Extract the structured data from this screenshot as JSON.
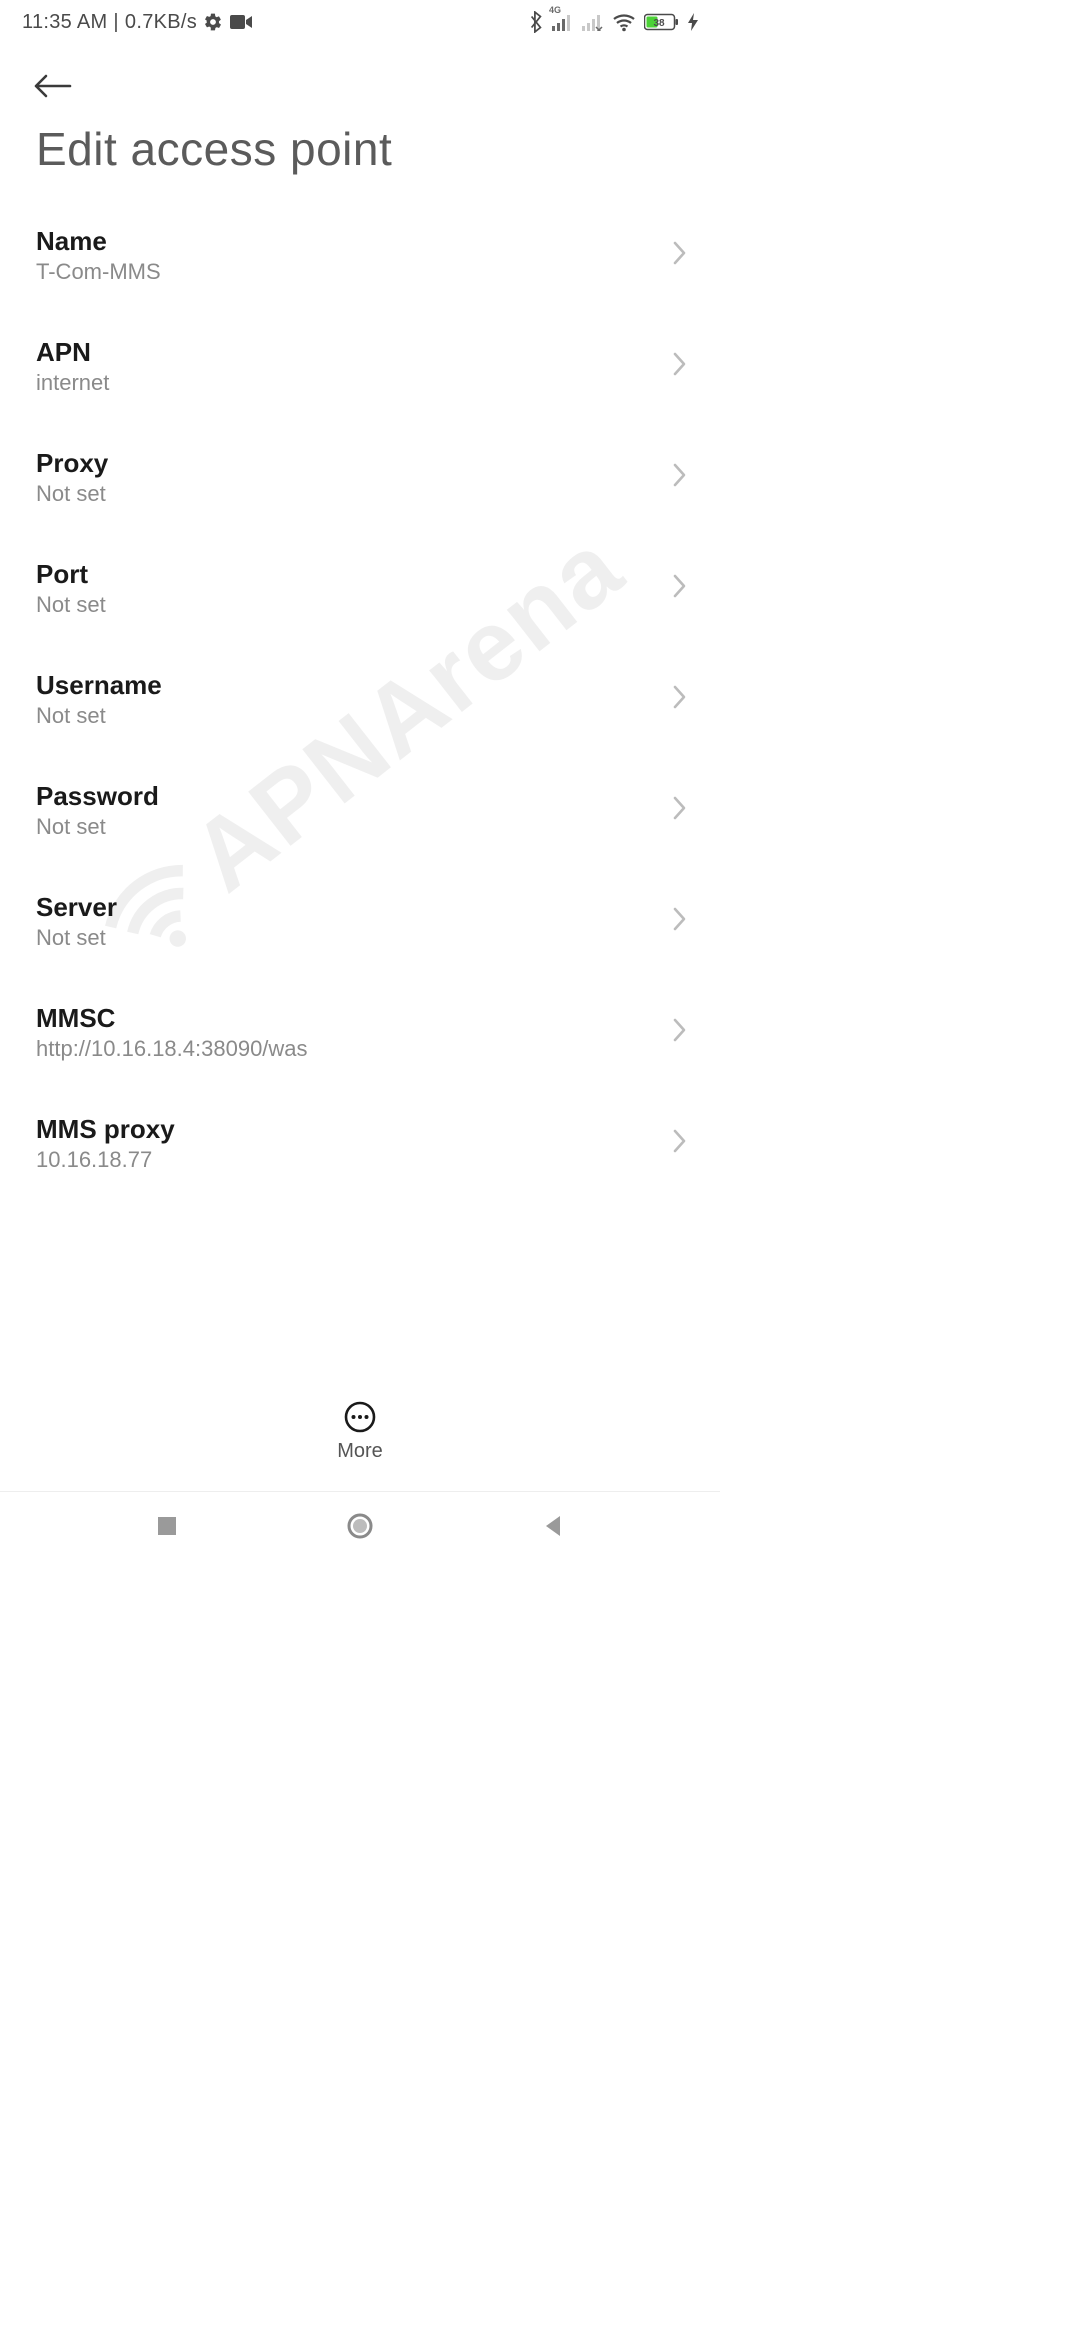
{
  "status": {
    "time": "11:35 AM",
    "divider": "|",
    "net_speed": "0.7KB/s",
    "net_label": "4G",
    "battery_percent": "38"
  },
  "header": {
    "title": "Edit access point"
  },
  "settings": [
    {
      "key": "name",
      "label": "Name",
      "value": "T-Com-MMS"
    },
    {
      "key": "apn",
      "label": "APN",
      "value": "internet"
    },
    {
      "key": "proxy",
      "label": "Proxy",
      "value": "Not set"
    },
    {
      "key": "port",
      "label": "Port",
      "value": "Not set"
    },
    {
      "key": "username",
      "label": "Username",
      "value": "Not set"
    },
    {
      "key": "password",
      "label": "Password",
      "value": "Not set"
    },
    {
      "key": "server",
      "label": "Server",
      "value": "Not set"
    },
    {
      "key": "mmsc",
      "label": "MMSC",
      "value": "http://10.16.18.4:38090/was"
    },
    {
      "key": "mms_proxy",
      "label": "MMS proxy",
      "value": "10.16.18.77"
    }
  ],
  "dock": {
    "more_label": "More"
  },
  "watermark": {
    "text": "APNArena"
  }
}
